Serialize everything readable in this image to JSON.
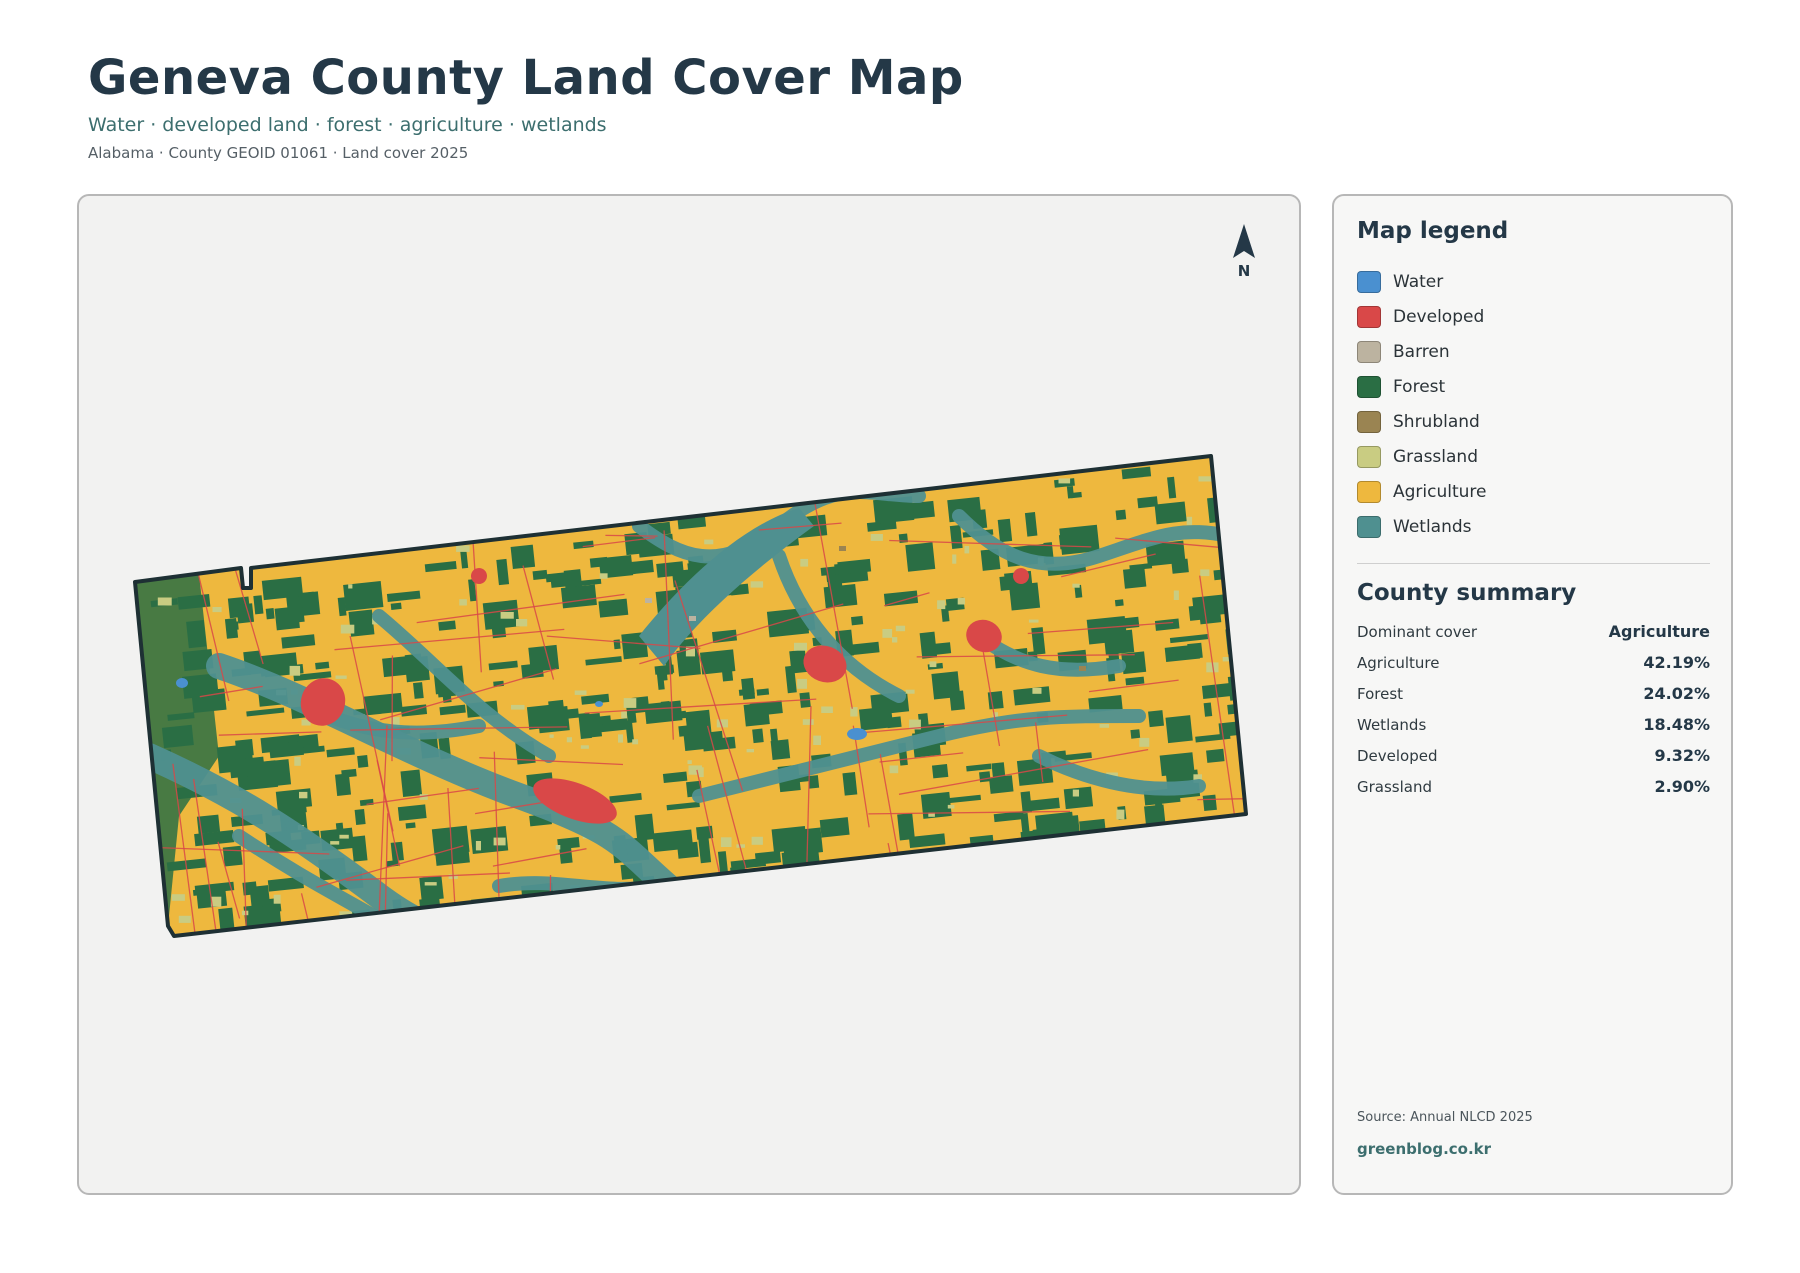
{
  "header": {
    "title": "Geneva County Land Cover Map",
    "subtitle": "Water · developed land · forest · agriculture · wetlands",
    "meta": "Alabama · County GEOID 01061 · Land cover 2025"
  },
  "map": {
    "north_label": "N",
    "colors": {
      "water": "#4a90d0",
      "developed": "#d94848",
      "barren": "#bcb3a0",
      "forest": "#2a6e44",
      "shrubland": "#9a8452",
      "grassland": "#c9cc82",
      "agriculture": "#eeb83e",
      "wetlands": "#4f9090",
      "boundary": "#1e3034"
    }
  },
  "legend": {
    "heading": "Map legend",
    "items": [
      {
        "label": "Water",
        "color": "#4a90d0"
      },
      {
        "label": "Developed",
        "color": "#d94848"
      },
      {
        "label": "Barren",
        "color": "#bcb3a0"
      },
      {
        "label": "Forest",
        "color": "#2a6e44"
      },
      {
        "label": "Shrubland",
        "color": "#9a8452"
      },
      {
        "label": "Grassland",
        "color": "#c9cc82"
      },
      {
        "label": "Agriculture",
        "color": "#eeb83e"
      },
      {
        "label": "Wetlands",
        "color": "#4f9090"
      }
    ]
  },
  "summary": {
    "heading": "County summary",
    "rows": [
      {
        "key": "Dominant cover",
        "value": "Agriculture"
      },
      {
        "key": "Agriculture",
        "value": "42.19%"
      },
      {
        "key": "Forest",
        "value": "24.02%"
      },
      {
        "key": "Wetlands",
        "value": "18.48%"
      },
      {
        "key": "Developed",
        "value": "9.32%"
      },
      {
        "key": "Grassland",
        "value": "2.90%"
      }
    ]
  },
  "footer": {
    "source": "Source: Annual NLCD 2025",
    "credit": "greenblog.co.kr"
  }
}
